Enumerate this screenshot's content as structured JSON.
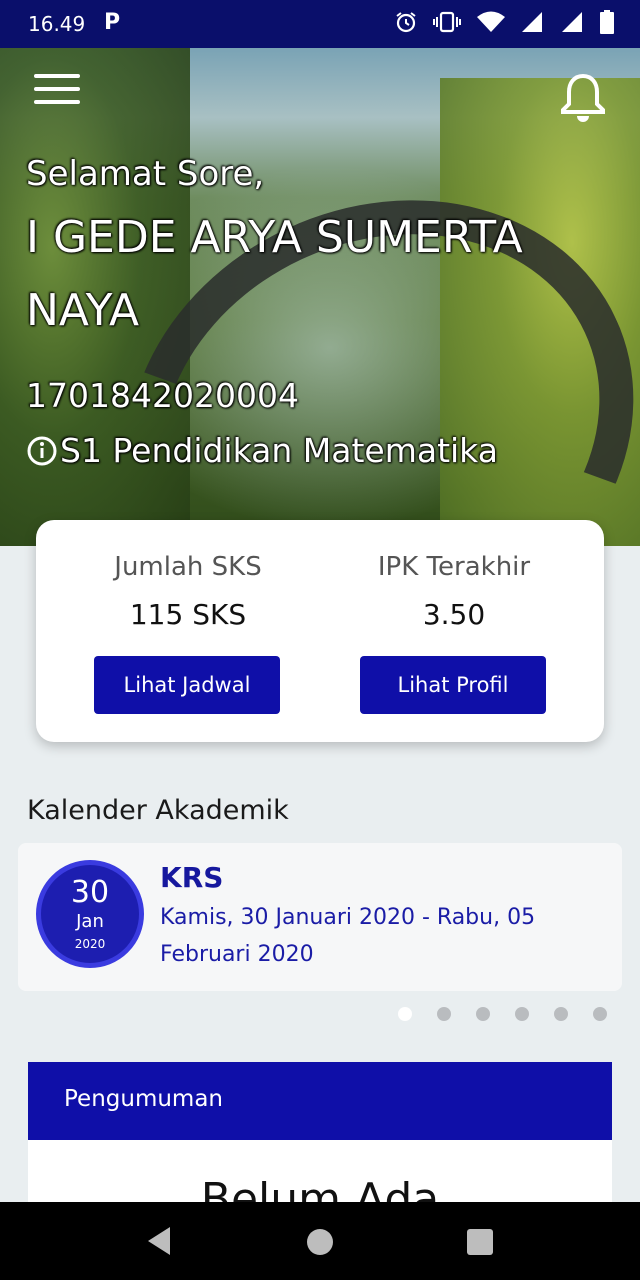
{
  "status_bar": {
    "time": "16.49",
    "app_indicator": "P",
    "icons": [
      "alarm-icon",
      "vibrate-icon",
      "wifi-icon",
      "signal-icon",
      "signal-icon",
      "battery-icon"
    ]
  },
  "header": {
    "menu_icon": "hamburger-icon",
    "notification_icon": "bell-icon"
  },
  "greeting": "Selamat Sore,",
  "student": {
    "name_line1": "I GEDE ARYA SUMERTA",
    "name_line2": "NAYA",
    "nim": "1701842020004",
    "program_icon": "info-icon",
    "program": "S1 Pendidikan Matematika"
  },
  "stats": {
    "sks_label": "Jumlah SKS",
    "sks_value": "115 SKS",
    "ipk_label": "IPK Terakhir",
    "ipk_value": "3.50",
    "schedule_button": "Lihat Jadwal",
    "profile_button": "Lihat Profil"
  },
  "calendar": {
    "title": "Kalender Akademik",
    "event": {
      "day": "30",
      "month": "Jan",
      "year": "2020",
      "name": "KRS",
      "range_line1": "Kamis, 30 Januari 2020 - Rabu, 05",
      "range_line2": "Februari 2020"
    },
    "pager": {
      "count": 6,
      "active": 1
    }
  },
  "announcement": {
    "title": "Pengumuman",
    "empty_text": "Belum Ada"
  },
  "colors": {
    "status_bar": "#0a0f6b",
    "primary": "#0f0fa8",
    "accent_text": "#16189e",
    "background": "#e9eef0"
  }
}
